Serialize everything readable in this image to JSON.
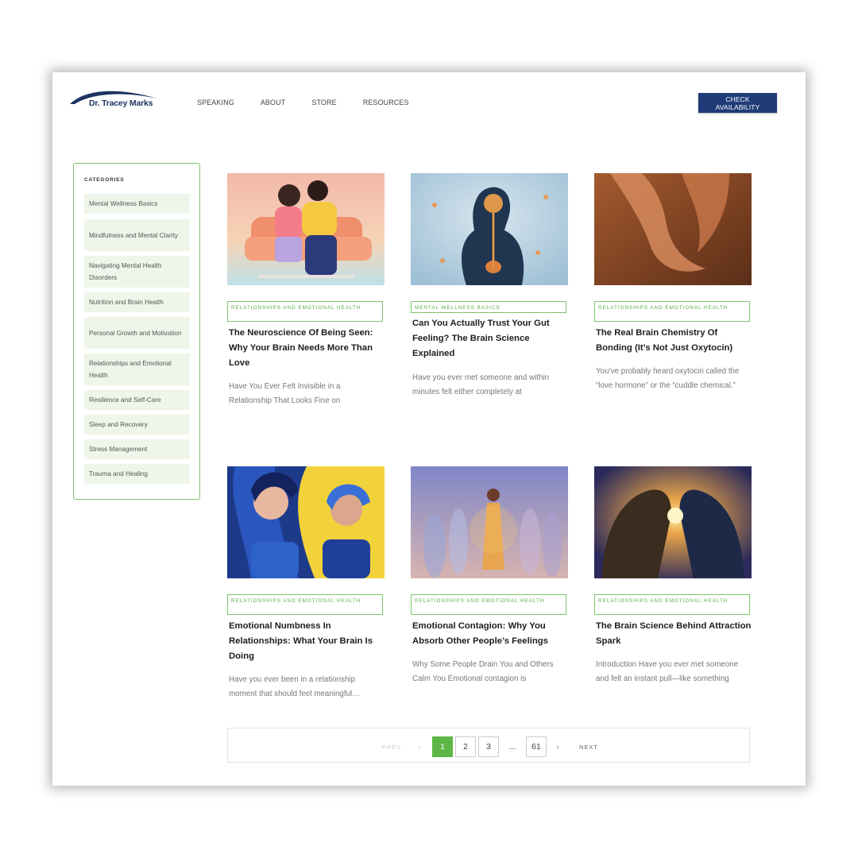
{
  "header": {
    "logo_text": "Dr. Tracey Marks",
    "nav": [
      "SPEAKING",
      "ABOUT",
      "STORE",
      "RESOURCES"
    ],
    "cta_label": "CHECK AVAILABILITY"
  },
  "sidebar": {
    "heading": "CATEGORIES",
    "items": [
      "Mental Wellness Basics",
      "Mindfulness and Mental Clarity",
      "Navigating Mental Health Disorders",
      "Nutrition and Brain Health",
      "Personal Growth and Motivation",
      "Relationships and Emotional Health",
      "Resilience and Self-Care",
      "Sleep and Recovery",
      "Stress Management",
      "Trauma and Healing"
    ]
  },
  "posts": [
    {
      "category": "RELATIONSHIPS AND EMOTIONAL HEALTH",
      "title": "The Neuroscience Of Being Seen: Why Your Brain Needs More Than Love",
      "excerpt": " Have You Ever Felt Invisible in a Relationship That Looks Fine on"
    },
    {
      "category": "MENTAL WELLNESS BASICS",
      "title": "Can You Actually Trust Your Gut Feeling? The Brain Science Explained",
      "excerpt": "Have you ever met someone and within minutes felt either completely at"
    },
    {
      "category": "RELATIONSHIPS AND EMOTIONAL HEALTH",
      "title": "The Real Brain Chemistry Of Bonding (It’s Not Just Oxytocin)",
      "excerpt": "You’ve probably heard oxytocin called the “love hormone” or the “cuddle chemical.”"
    },
    {
      "category": "RELATIONSHIPS AND EMOTIONAL HEALTH",
      "title": "Emotional Numbness In Relationships: What Your Brain Is Doing",
      "excerpt": "Have you ever been in a relationship moment that should feel meaningful…"
    },
    {
      "category": "RELATIONSHIPS AND EMOTIONAL HEALTH",
      "title": "Emotional Contagion: Why You Absorb Other People’s Feelings",
      "excerpt": "Why Some People Drain You and Others Calm You Emotional contagion is"
    },
    {
      "category": "RELATIONSHIPS AND EMOTIONAL HEALTH",
      "title": "The Brain Science Behind Attraction Spark",
      "excerpt": "Introduction Have you ever met someone and felt an instant pull—like something"
    }
  ],
  "pagination": {
    "prev": "PREV",
    "pages": [
      "1",
      "2",
      "3"
    ],
    "ellipsis": "...",
    "last": "61",
    "next": "NEXT",
    "current": "1"
  },
  "colors": {
    "accent_green": "#5cb746",
    "brand_navy": "#1f3b78"
  }
}
